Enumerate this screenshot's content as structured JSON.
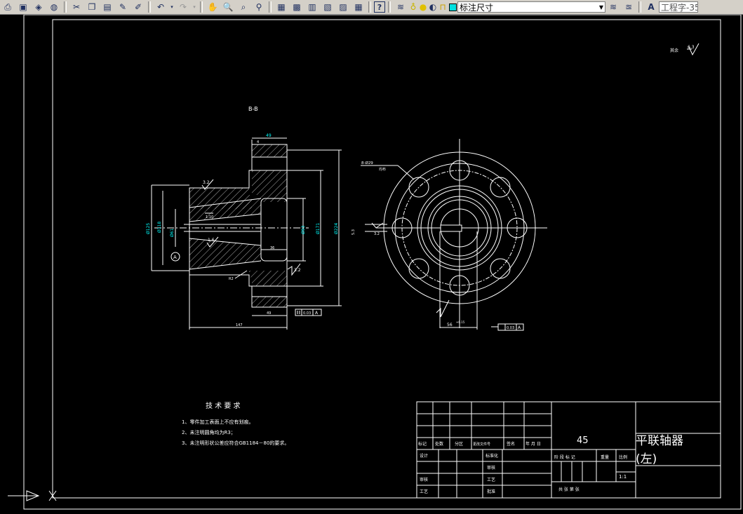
{
  "toolbar": {
    "layer_name": "标注尺寸",
    "text_style": "工程字-35"
  },
  "drawing": {
    "section_label": "B-B",
    "roughness_note": "其余",
    "roughness_value": "6.3",
    "tech_title": "技 术 要 求",
    "tech_items": [
      "1、零件加工表面上不应有划痕。",
      "2、未注明圆角均为R3；",
      "3、未注明形状公差应符合GB1184－80的要求。"
    ],
    "dims": {
      "top_width": "49",
      "top_small": "4",
      "d_outer": "Ø125",
      "d_118": "Ø118",
      "d_61": "Ø61",
      "d_93": "Ø93",
      "d_171": "Ø171",
      "d_224": "Ø224",
      "bore_len": "36",
      "bottom_49": "49",
      "total_len": "147",
      "slope": "1:10",
      "r2": "R2",
      "rough_32a": "3.2",
      "rough_16": "1.6",
      "rough_32b": "3.2",
      "rough_32c": "3.2",
      "datum": "A",
      "holes": "8-Ø29",
      "holes_note": "均布",
      "key_56": "56",
      "key_tol": "+0.15",
      "tol_a": "0.03",
      "tol_b": "0.03",
      "fit": "5.3"
    },
    "title_block": {
      "material": "45",
      "part_name_1": "平联轴器",
      "part_name_2": "(左)",
      "scale": "1:1",
      "h_mark": "标记",
      "h_count": "处数",
      "h_zone": "分区",
      "h_doc": "更改文件号",
      "h_sign": "签名",
      "h_date": "年 月 日",
      "h_design": "设计",
      "h_std": "标准化",
      "h_check": "审核",
      "h_craft": "工艺",
      "h_approve": "批准",
      "h_stage": "阶 段 标 记",
      "h_weight": "重量",
      "h_ratio": "比例",
      "h_sheets": "共    张    第    张"
    }
  }
}
